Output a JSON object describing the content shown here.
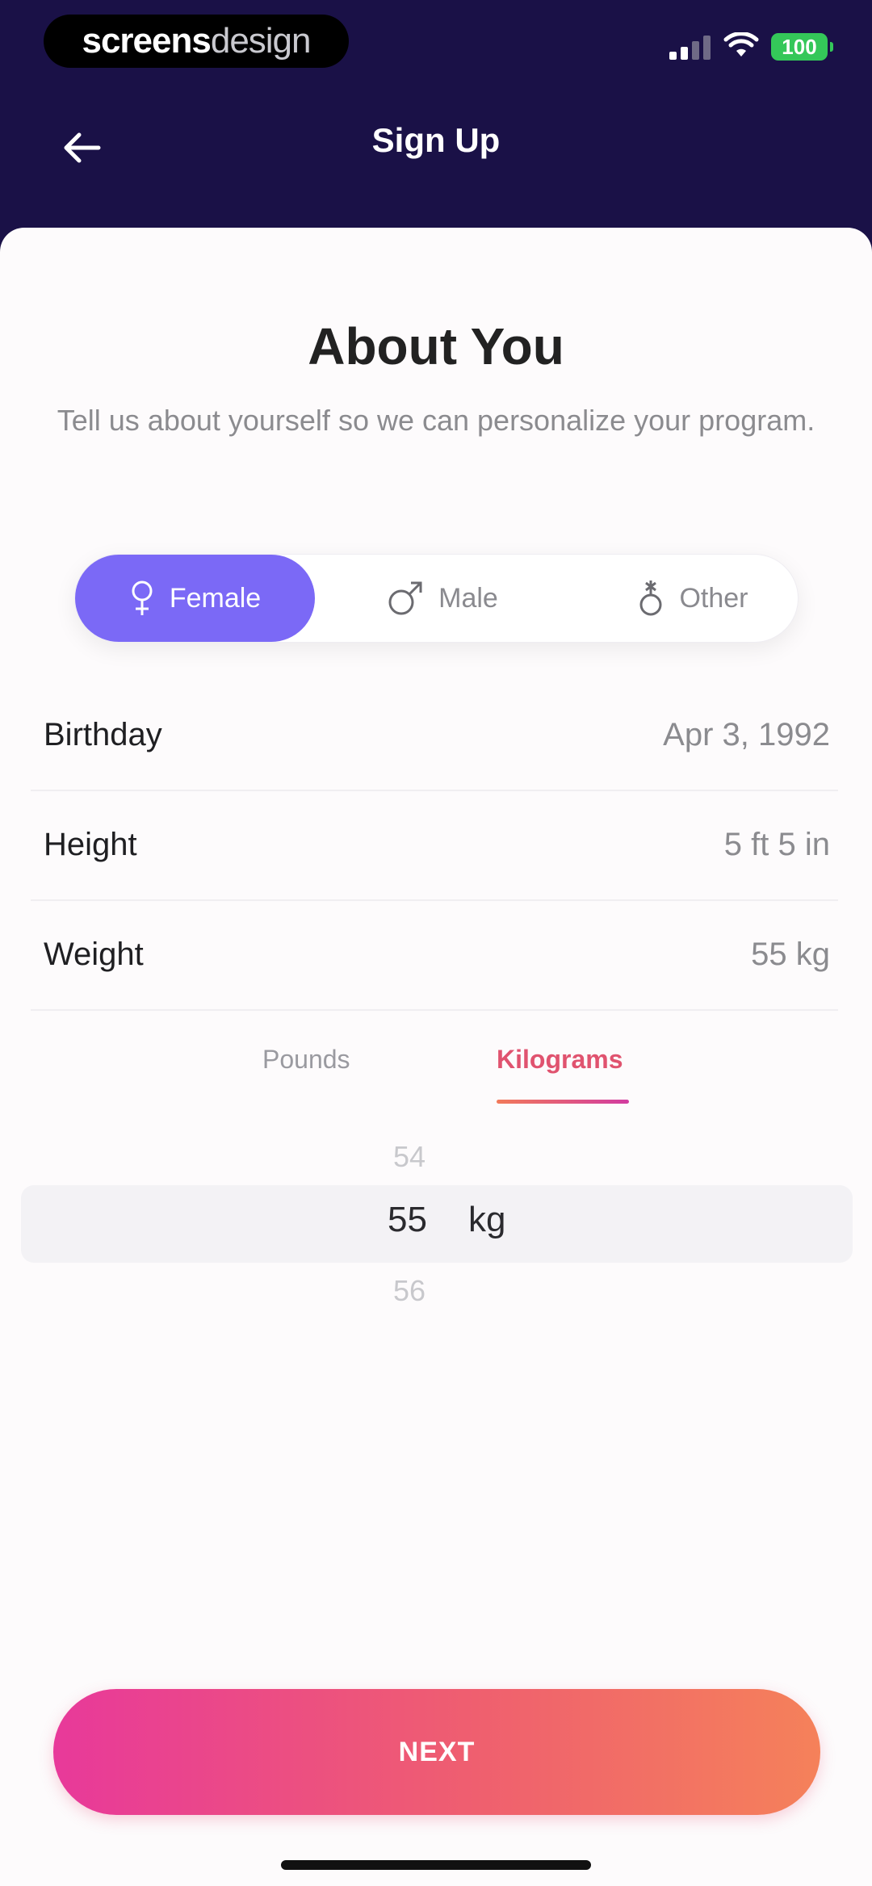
{
  "status_bar": {
    "brand_bold": "screens",
    "brand_light": "design",
    "battery": "100"
  },
  "nav": {
    "title": "Sign Up"
  },
  "header": {
    "title": "About You",
    "subtitle": "Tell us about yourself so we can personalize your program."
  },
  "gender": {
    "options": [
      {
        "label": "Female",
        "icon": "female-icon",
        "selected": true
      },
      {
        "label": "Male",
        "icon": "male-icon",
        "selected": false
      },
      {
        "label": "Other",
        "icon": "other-gender-icon",
        "selected": false
      }
    ]
  },
  "fields": [
    {
      "label": "Birthday",
      "value": "Apr 3, 1992"
    },
    {
      "label": "Height",
      "value": "5 ft 5 in"
    },
    {
      "label": "Weight",
      "value": "55 kg"
    }
  ],
  "units": {
    "pounds": "Pounds",
    "kilograms": "Kilograms",
    "selected": "Kilograms"
  },
  "picker": {
    "prev": "54",
    "value": "55",
    "unit": "kg",
    "next": "56"
  },
  "footer": {
    "next_label": "NEXT"
  },
  "colors": {
    "header_bg": "#1a1147",
    "accent_purple": "#7b69f6",
    "gradient_start": "#e8399a",
    "gradient_end": "#f5815a"
  }
}
